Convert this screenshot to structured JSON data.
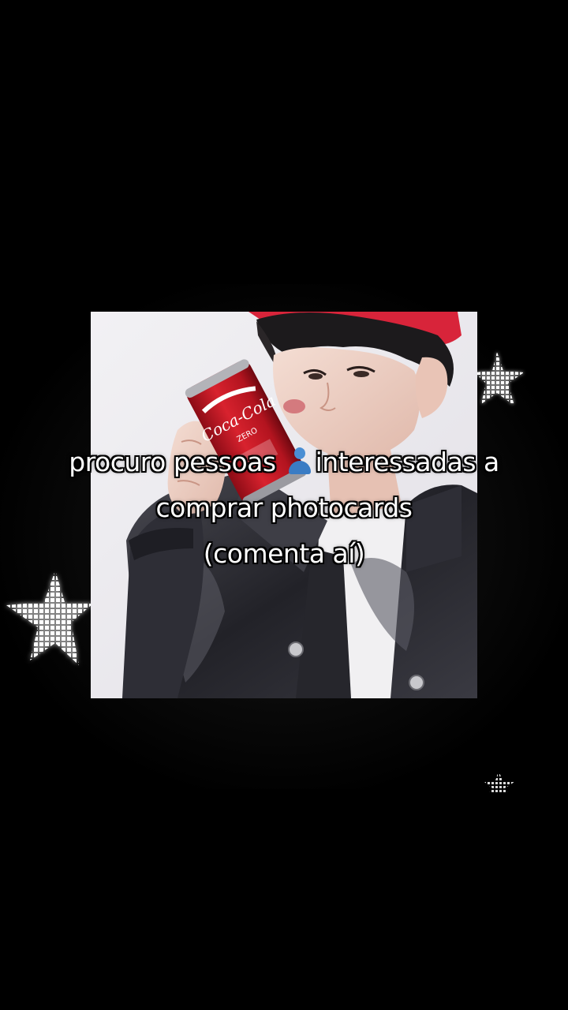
{
  "caption": {
    "line1_before_icon": "procuro pessoas",
    "line1_icon": "person-silhouette-icon",
    "line1_after_icon": "interessadas a",
    "line2": "comprar photocards",
    "line3": "(comenta aí)"
  },
  "photo": {
    "can_brand": "Coca-Cola",
    "can_variant": "ZERO"
  },
  "colors": {
    "background": "#000000",
    "caption_text": "#ffffff",
    "icon_blue": "#3a7cc4",
    "can_red": "#d0182a",
    "cap_red": "#d8243a",
    "star_light": "#ffffff"
  }
}
